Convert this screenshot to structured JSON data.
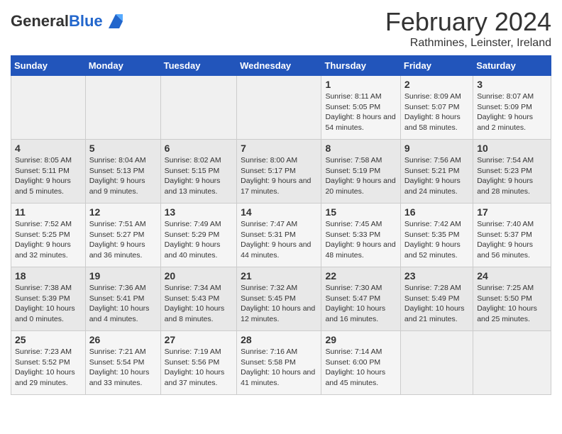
{
  "header": {
    "logo_general": "General",
    "logo_blue": "Blue",
    "main_title": "February 2024",
    "subtitle": "Rathmines, Leinster, Ireland"
  },
  "days_of_week": [
    "Sunday",
    "Monday",
    "Tuesday",
    "Wednesday",
    "Thursday",
    "Friday",
    "Saturday"
  ],
  "weeks": [
    [
      {
        "day": "",
        "info": ""
      },
      {
        "day": "",
        "info": ""
      },
      {
        "day": "",
        "info": ""
      },
      {
        "day": "",
        "info": ""
      },
      {
        "day": "1",
        "info": "Sunrise: 8:11 AM\nSunset: 5:05 PM\nDaylight: 8 hours and 54 minutes."
      },
      {
        "day": "2",
        "info": "Sunrise: 8:09 AM\nSunset: 5:07 PM\nDaylight: 8 hours and 58 minutes."
      },
      {
        "day": "3",
        "info": "Sunrise: 8:07 AM\nSunset: 5:09 PM\nDaylight: 9 hours and 2 minutes."
      }
    ],
    [
      {
        "day": "4",
        "info": "Sunrise: 8:05 AM\nSunset: 5:11 PM\nDaylight: 9 hours and 5 minutes."
      },
      {
        "day": "5",
        "info": "Sunrise: 8:04 AM\nSunset: 5:13 PM\nDaylight: 9 hours and 9 minutes."
      },
      {
        "day": "6",
        "info": "Sunrise: 8:02 AM\nSunset: 5:15 PM\nDaylight: 9 hours and 13 minutes."
      },
      {
        "day": "7",
        "info": "Sunrise: 8:00 AM\nSunset: 5:17 PM\nDaylight: 9 hours and 17 minutes."
      },
      {
        "day": "8",
        "info": "Sunrise: 7:58 AM\nSunset: 5:19 PM\nDaylight: 9 hours and 20 minutes."
      },
      {
        "day": "9",
        "info": "Sunrise: 7:56 AM\nSunset: 5:21 PM\nDaylight: 9 hours and 24 minutes."
      },
      {
        "day": "10",
        "info": "Sunrise: 7:54 AM\nSunset: 5:23 PM\nDaylight: 9 hours and 28 minutes."
      }
    ],
    [
      {
        "day": "11",
        "info": "Sunrise: 7:52 AM\nSunset: 5:25 PM\nDaylight: 9 hours and 32 minutes."
      },
      {
        "day": "12",
        "info": "Sunrise: 7:51 AM\nSunset: 5:27 PM\nDaylight: 9 hours and 36 minutes."
      },
      {
        "day": "13",
        "info": "Sunrise: 7:49 AM\nSunset: 5:29 PM\nDaylight: 9 hours and 40 minutes."
      },
      {
        "day": "14",
        "info": "Sunrise: 7:47 AM\nSunset: 5:31 PM\nDaylight: 9 hours and 44 minutes."
      },
      {
        "day": "15",
        "info": "Sunrise: 7:45 AM\nSunset: 5:33 PM\nDaylight: 9 hours and 48 minutes."
      },
      {
        "day": "16",
        "info": "Sunrise: 7:42 AM\nSunset: 5:35 PM\nDaylight: 9 hours and 52 minutes."
      },
      {
        "day": "17",
        "info": "Sunrise: 7:40 AM\nSunset: 5:37 PM\nDaylight: 9 hours and 56 minutes."
      }
    ],
    [
      {
        "day": "18",
        "info": "Sunrise: 7:38 AM\nSunset: 5:39 PM\nDaylight: 10 hours and 0 minutes."
      },
      {
        "day": "19",
        "info": "Sunrise: 7:36 AM\nSunset: 5:41 PM\nDaylight: 10 hours and 4 minutes."
      },
      {
        "day": "20",
        "info": "Sunrise: 7:34 AM\nSunset: 5:43 PM\nDaylight: 10 hours and 8 minutes."
      },
      {
        "day": "21",
        "info": "Sunrise: 7:32 AM\nSunset: 5:45 PM\nDaylight: 10 hours and 12 minutes."
      },
      {
        "day": "22",
        "info": "Sunrise: 7:30 AM\nSunset: 5:47 PM\nDaylight: 10 hours and 16 minutes."
      },
      {
        "day": "23",
        "info": "Sunrise: 7:28 AM\nSunset: 5:49 PM\nDaylight: 10 hours and 21 minutes."
      },
      {
        "day": "24",
        "info": "Sunrise: 7:25 AM\nSunset: 5:50 PM\nDaylight: 10 hours and 25 minutes."
      }
    ],
    [
      {
        "day": "25",
        "info": "Sunrise: 7:23 AM\nSunset: 5:52 PM\nDaylight: 10 hours and 29 minutes."
      },
      {
        "day": "26",
        "info": "Sunrise: 7:21 AM\nSunset: 5:54 PM\nDaylight: 10 hours and 33 minutes."
      },
      {
        "day": "27",
        "info": "Sunrise: 7:19 AM\nSunset: 5:56 PM\nDaylight: 10 hours and 37 minutes."
      },
      {
        "day": "28",
        "info": "Sunrise: 7:16 AM\nSunset: 5:58 PM\nDaylight: 10 hours and 41 minutes."
      },
      {
        "day": "29",
        "info": "Sunrise: 7:14 AM\nSunset: 6:00 PM\nDaylight: 10 hours and 45 minutes."
      },
      {
        "day": "",
        "info": ""
      },
      {
        "day": "",
        "info": ""
      }
    ]
  ]
}
